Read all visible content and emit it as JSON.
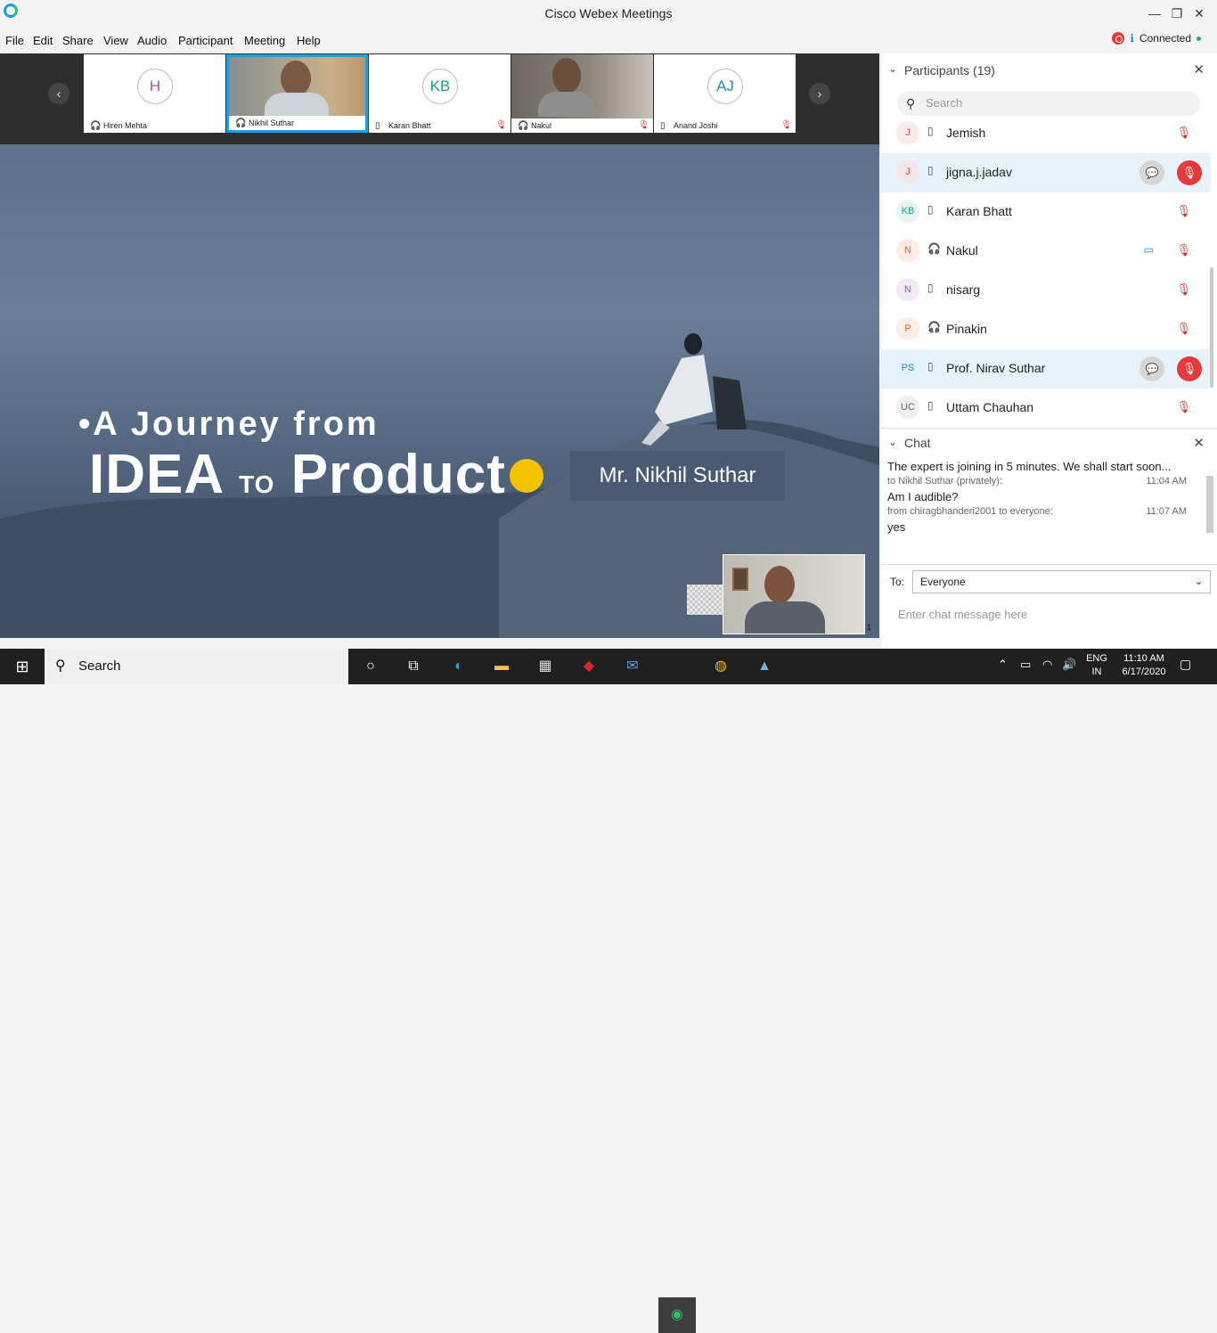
{
  "window": {
    "title": "Cisco Webex Meetings",
    "minimize": "—",
    "restore": "❐",
    "close": "✕"
  },
  "menu": [
    "File",
    "Edit",
    "Share",
    "View",
    "Audio",
    "Participant",
    "Meeting",
    "Help"
  ],
  "status": {
    "connection": "Connected"
  },
  "tiles": [
    {
      "name": "Hiren Mehta",
      "initials": "H",
      "color": "#9b59b6"
    },
    {
      "name": "Nikhil Suthar",
      "initials": "",
      "color": "#000000"
    },
    {
      "name": "Karan Bhatt",
      "initials": "KB",
      "color": "#1aa085"
    },
    {
      "name": "Nakul",
      "initials": "",
      "color": "#000000"
    },
    {
      "name": "Anand Joshi",
      "initials": "AJ",
      "color": "#1f8ad0"
    }
  ],
  "slide": {
    "line1": "•A Journey from",
    "line2a": "IDEA",
    "line2b": "TO",
    "line2c": "Product",
    "speaker": "Mr. Nikhil Suthar",
    "page": "1"
  },
  "participants": {
    "header": "Participants (19)",
    "search_placeholder": "Search",
    "items": [
      {
        "initials": "J",
        "name": "Jemish",
        "color": "#e5484d"
      },
      {
        "initials": "J",
        "name": "jigna.j.jadav",
        "color": "#e5484d"
      },
      {
        "initials": "KB",
        "name": "Karan Bhatt",
        "color": "#1aa085"
      },
      {
        "initials": "N",
        "name": "Nakul",
        "color": "#e8632b"
      },
      {
        "initials": "N",
        "name": "nisarg",
        "color": "#9b59b6"
      },
      {
        "initials": "P",
        "name": "Pinakin",
        "color": "#e8632b"
      },
      {
        "initials": "PS",
        "name": "Prof. Nirav Suthar",
        "color": "#1f8ad0"
      },
      {
        "initials": "UC",
        "name": "Uttam Chauhan",
        "color": "#666666"
      }
    ]
  },
  "chat": {
    "header": "Chat",
    "messages": [
      {
        "text": "The expert is joining in 5 minutes. We shall start soon..."
      },
      {
        "meta": "to Nikhil Suthar (privately):",
        "time": "11:04 AM",
        "text": "Am I audible?"
      },
      {
        "meta": "from chiragbhanderi2001 to everyone:",
        "time": "11:07 AM",
        "text": "yes"
      }
    ],
    "to_label": "To:",
    "to_value": "Everyone",
    "input_placeholder": "Enter chat message here"
  },
  "taskbar": {
    "search": "Search",
    "lang1": "ENG",
    "lang2": "IN",
    "time": "11:10 AM",
    "date": "6/17/2020"
  }
}
